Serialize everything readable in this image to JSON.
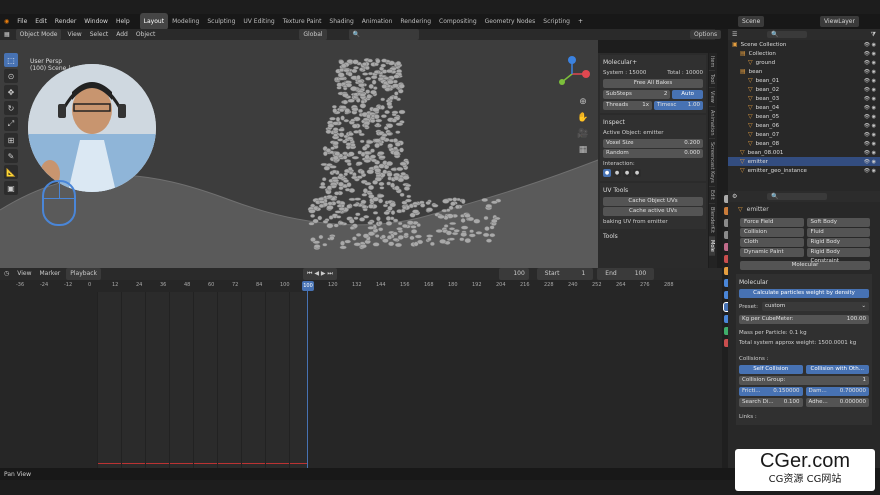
{
  "menu": {
    "items": [
      "File",
      "Edit",
      "Render",
      "Window",
      "Help"
    ],
    "workspaces": [
      "Layout",
      "Modeling",
      "Sculpting",
      "UV Editing",
      "Texture Paint",
      "Shading",
      "Animation",
      "Rendering",
      "Compositing",
      "Geometry Nodes",
      "Scripting"
    ],
    "scene": "Scene",
    "view_layer": "ViewLayer"
  },
  "viewport": {
    "mode": "Object Mode",
    "menus": [
      "View",
      "Select",
      "Add",
      "Object"
    ],
    "orientation": "Global",
    "overlay_text_1": "User Persp",
    "overlay_text_2": "(100) Scene | emitter",
    "options": "Options"
  },
  "npanel": {
    "molecular_title": "Molecular+",
    "system_label": "System : 15000",
    "total_label": "Total : 10000",
    "free_bakes": "Free All Bakes",
    "substeps_label": "SubSteps",
    "substeps_val": "2",
    "auto": "Auto",
    "threads_label": "Threads",
    "threads_val": "1x",
    "timescale_label": "Timesc",
    "timescale_val": "1.00",
    "inspect_title": "Inspect",
    "active_object": "Active Object: emitter",
    "voxel_label": "Voxel Size",
    "voxel_val": "0.200",
    "random_label": "Random",
    "random_val": "0.000",
    "interaction": "Interaction:",
    "uv_title": "UV Tools",
    "cache_uv": "Cache Object UVs",
    "cache_active": "Cache active UVs",
    "baking_text": "baking UV from emitter",
    "tools_title": "Tools",
    "tabs": [
      "Item",
      "Tool",
      "View",
      "Animation",
      "Screencast Keys",
      "Edit",
      "BlenderKit",
      "Mole"
    ]
  },
  "timeline": {
    "menus": [
      "View",
      "Marker",
      "Playback"
    ],
    "current": "100",
    "start_label": "Start",
    "start": "1",
    "end_label": "End",
    "end": "100",
    "ticks": [
      "-36",
      "-24",
      "-12",
      "0",
      "12",
      "24",
      "36",
      "48",
      "60",
      "72",
      "84",
      "100",
      "108",
      "120",
      "132",
      "144",
      "156",
      "168",
      "180",
      "192",
      "204",
      "216",
      "228",
      "240",
      "252",
      "264",
      "276",
      "288"
    ]
  },
  "status": {
    "left": "Pan View"
  },
  "outliner": {
    "search_placeholder": "",
    "rows": [
      {
        "name": "Scene Collection",
        "indent": 0,
        "sel": false
      },
      {
        "name": "Collection",
        "indent": 1,
        "sel": false
      },
      {
        "name": "ground",
        "indent": 2,
        "sel": false
      },
      {
        "name": "bean",
        "indent": 1,
        "sel": false
      },
      {
        "name": "bean_01",
        "indent": 2,
        "sel": false
      },
      {
        "name": "bean_02",
        "indent": 2,
        "sel": false
      },
      {
        "name": "bean_03",
        "indent": 2,
        "sel": false
      },
      {
        "name": "bean_04",
        "indent": 2,
        "sel": false
      },
      {
        "name": "bean_05",
        "indent": 2,
        "sel": false
      },
      {
        "name": "bean_06",
        "indent": 2,
        "sel": false
      },
      {
        "name": "bean_07",
        "indent": 2,
        "sel": false
      },
      {
        "name": "bean_08",
        "indent": 2,
        "sel": false
      },
      {
        "name": "bean_08.001",
        "indent": 1,
        "sel": false
      },
      {
        "name": "emitter",
        "indent": 1,
        "sel": true
      },
      {
        "name": "emitter_geo_instance",
        "indent": 1,
        "sel": false
      }
    ]
  },
  "props": {
    "object": "emitter",
    "physics": [
      "Force Field",
      "Soft Body",
      "Collision",
      "Fluid",
      "Cloth",
      "Rigid Body",
      "Dynamic Paint",
      "Rigid Body Constraint"
    ],
    "molecular_btn": "Molecular",
    "molecular_hdr": "Molecular",
    "calc_btn": "Calculate particles weight by density",
    "preset_label": "Preset:",
    "preset_val": "custom",
    "kg_label": "Kg per CubeMeter:",
    "kg_val": "100.00",
    "mass_text": "Mass per Particle: 0.1 kg",
    "total_weight": "Total system approx weight: 1500.0001 kg",
    "collisions": "Collisions :",
    "self_coll": "Self Collision",
    "coll_others": "Collision with Oth...",
    "group_label": "Collision Group:",
    "group_val": "1",
    "friction_label": "Fricti...",
    "friction_val": "0.150000",
    "damp_label": "Dam...",
    "damp_val": "0.700000",
    "search_label": "Search Di...",
    "search_val": "0.100",
    "adhes_label": "Adhe...",
    "adhes_val": "0.000000",
    "links": "Links :"
  },
  "watermark": {
    "line1": "CGer.com",
    "line2": "CG资源 CG网站"
  }
}
